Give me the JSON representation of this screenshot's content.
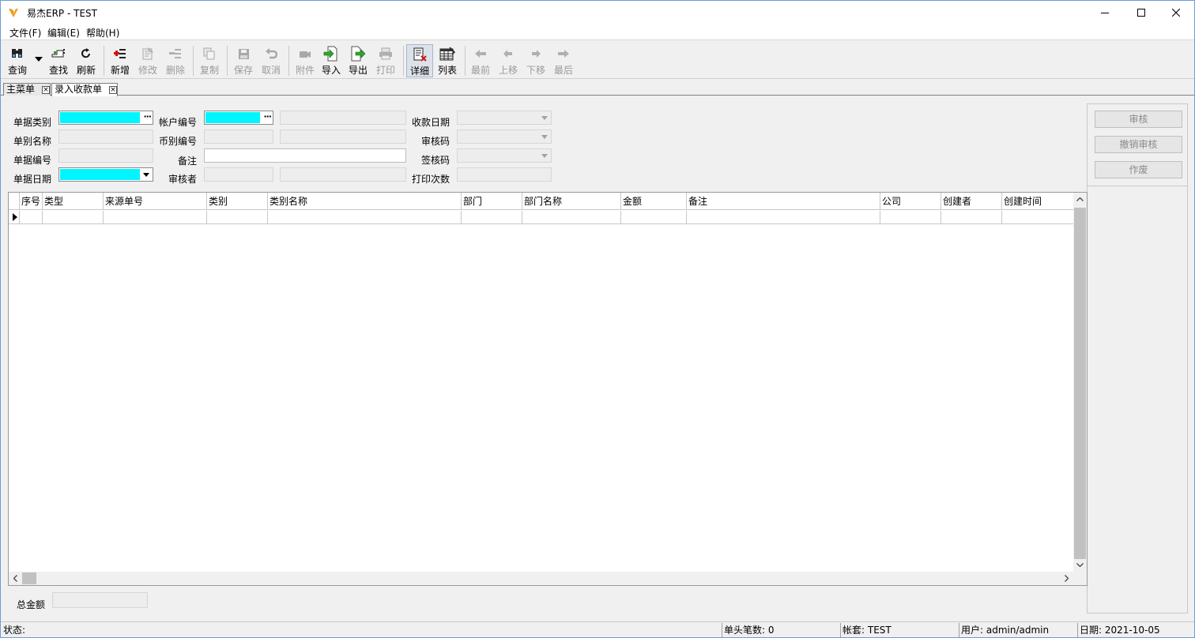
{
  "window": {
    "title": "易杰ERP - TEST",
    "minimize_icon": "minimize-icon",
    "maximize_icon": "maximize-icon",
    "close_icon": "close-icon"
  },
  "menu": {
    "items": [
      "文件(F)",
      "编辑(E)",
      "帮助(H)"
    ]
  },
  "toolbar": {
    "query": "查询",
    "find": "查找",
    "refresh": "刷新",
    "add": "新增",
    "edit": "修改",
    "delete": "删除",
    "copy": "复制",
    "save": "保存",
    "cancel": "取消",
    "attach": "附件",
    "import": "导入",
    "export": "导出",
    "print": "打印",
    "detail": "详细",
    "list": "列表",
    "first": "最前",
    "prev": "上移",
    "next": "下移",
    "last": "最后"
  },
  "tabs": [
    {
      "label": "主菜单"
    },
    {
      "label": "录入收款单"
    }
  ],
  "form": {
    "doc_type_label": "单据类别",
    "doc_name_label": "单别名称",
    "doc_no_label": "单据编号",
    "doc_date_label": "单据日期",
    "account_no_label": "帐户编号",
    "currency_no_label": "币别编号",
    "remark_label": "备注",
    "auditor_label": "审核者",
    "receipt_date_label": "收款日期",
    "audit_code_label": "审核码",
    "sign_code_label": "签核码",
    "print_count_label": "打印次数",
    "ellipsis": "···"
  },
  "actions": {
    "audit": "审核",
    "unaudit": "撤销审核",
    "void": "作废"
  },
  "grid": {
    "columns": [
      "序号",
      "类型",
      "来源单号",
      "类别",
      "类别名称",
      "部门",
      "部门名称",
      "金额",
      "备注",
      "公司",
      "创建者",
      "创建时间"
    ]
  },
  "footer": {
    "total_label": "总金额"
  },
  "status": {
    "state": "状态:",
    "head_count": "单头笔数: 0",
    "account_set": "帐套: TEST",
    "user": "用户: admin/admin",
    "date": "日期: 2021-10-05"
  }
}
